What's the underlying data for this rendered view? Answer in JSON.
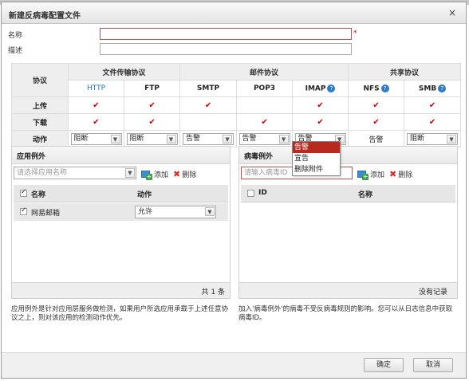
{
  "dialog": {
    "title": "新建反病毒配置文件",
    "close": "×"
  },
  "form": {
    "name_label": "名称",
    "name_value": "",
    "required_mark": "*",
    "desc_label": "描述",
    "desc_value": ""
  },
  "protocols": {
    "group_protocol": "协议",
    "group_file": "文件传输协议",
    "group_mail": "邮件协议",
    "group_share": "共享协议",
    "columns": [
      "HTTP",
      "FTP",
      "SMTP",
      "POP3",
      "IMAP",
      "NFS",
      "SMB"
    ],
    "row_upload": "上传",
    "row_download": "下载",
    "row_action": "动作",
    "upload": [
      true,
      true,
      true,
      false,
      true,
      true,
      true
    ],
    "download": [
      true,
      true,
      false,
      true,
      true,
      true,
      true
    ],
    "actions": [
      "阻断",
      "阻断",
      "告警",
      "告警",
      "告警",
      "告警",
      "阻断"
    ],
    "help": "?"
  },
  "action_menu": {
    "options": [
      "告警",
      "宣告",
      "删除附件"
    ],
    "selected": "告警"
  },
  "app_exception": {
    "title": "应用例外",
    "select_placeholder": "请选择应用名称",
    "add_label": "添加",
    "delete_label": "删除",
    "col_name": "名称",
    "col_action": "动作",
    "rows": [
      {
        "name": "网易邮箱",
        "action": "允许"
      }
    ],
    "count": "共 1 条"
  },
  "virus_exception": {
    "title": "病毒例外",
    "input_placeholder": "请输入病毒ID",
    "add_label": "添加",
    "delete_label": "删除",
    "col_id": "ID",
    "col_name": "名称",
    "empty": "没有记录"
  },
  "notes": {
    "app": "应用例外是针对应用层服务做检测，如果用户所选应用承载于上述任意协议之上，则对该应用的检测动作优先。",
    "virus": "加入'病毒例外'的病毒不受反病毒规则的影响。您可以从日志信息中获取病毒ID。"
  },
  "buttons": {
    "ok": "确定",
    "cancel": "取消"
  }
}
